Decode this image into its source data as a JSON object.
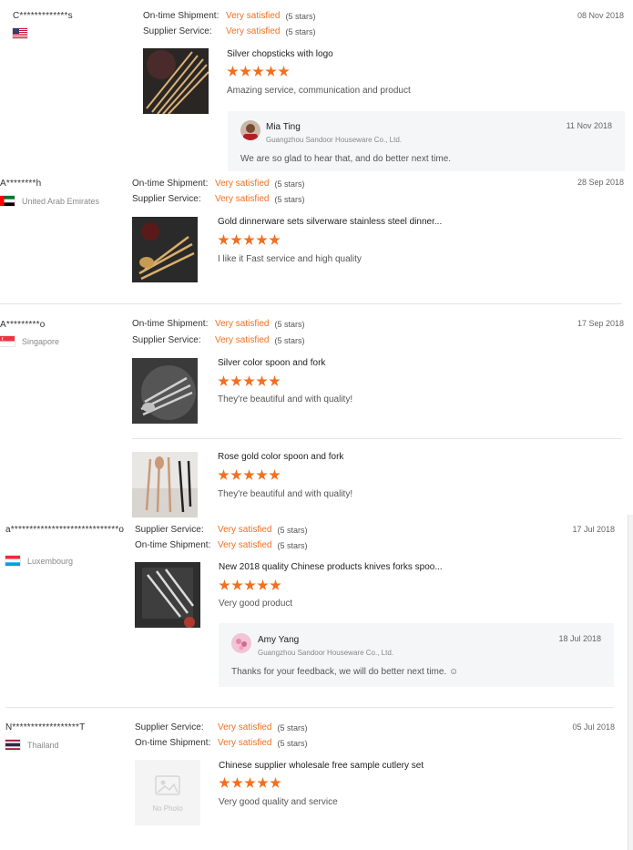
{
  "reviews": [
    {
      "buyer": "C*************s",
      "country": "",
      "flag": "us",
      "ratings": [
        {
          "label": "On-time Shipment:",
          "value": "Very satisfied",
          "stars": "(5 stars)"
        },
        {
          "label": "Supplier Service:",
          "value": "Very satisfied",
          "stars": "(5 stars)"
        }
      ],
      "date": "08 Nov 2018",
      "products": [
        {
          "title": "Silver chopsticks with logo",
          "rating": 5,
          "comment": "Amazing service, communication and product"
        }
      ],
      "reply": {
        "name": "Mia Ting",
        "company": "Guangzhou Sandoor Houseware Co., Ltd.",
        "date": "11 Nov 2018",
        "text": "We are so glad to hear that, and do better next time."
      }
    },
    {
      "buyer": "A********h",
      "country": "United Arab Emirates",
      "flag": "ae",
      "ratings": [
        {
          "label": "On-time Shipment:",
          "value": "Very satisfied",
          "stars": "(5 stars)"
        },
        {
          "label": "Supplier Service:",
          "value": "Very satisfied",
          "stars": "(5 stars)"
        }
      ],
      "date": "28 Sep 2018",
      "products": [
        {
          "title": "Gold dinnerware sets silverware stainless steel dinner...",
          "rating": 5,
          "comment": "I like it Fast service and high quality"
        }
      ]
    },
    {
      "buyer": "A*********o",
      "country": "Singapore",
      "flag": "sg",
      "ratings": [
        {
          "label": "On-time Shipment:",
          "value": "Very satisfied",
          "stars": "(5 stars)"
        },
        {
          "label": "Supplier Service:",
          "value": "Very satisfied",
          "stars": "(5 stars)"
        }
      ],
      "date": "17 Sep 2018",
      "products": [
        {
          "title": "Silver color spoon and fork",
          "rating": 5,
          "comment": "They're beautiful and with quality!"
        },
        {
          "title": "Rose gold color spoon and fork",
          "rating": 5,
          "comment": "They're beautiful and with quality!"
        }
      ]
    },
    {
      "buyer": "a*****************************o",
      "country": "Luxembourg",
      "flag": "lu",
      "ratings": [
        {
          "label": "Supplier Service:",
          "value": "Very satisfied",
          "stars": "(5 stars)"
        },
        {
          "label": "On-time Shipment:",
          "value": "Very satisfied",
          "stars": "(5 stars)"
        }
      ],
      "date": "17 Jul 2018",
      "products": [
        {
          "title": "New 2018 quality Chinese products knives forks spoo...",
          "rating": 5,
          "comment": "Very good product"
        }
      ],
      "reply": {
        "name": "Amy Yang",
        "company": "Guangzhou Sandoor Houseware Co., Ltd.",
        "date": "18 Jul 2018",
        "text": "Thanks for your feedback, we will do better next time. ☺"
      }
    },
    {
      "buyer": "N******************T",
      "country": "Thailand",
      "flag": "th",
      "ratings": [
        {
          "label": "Supplier Service:",
          "value": "Very satisfied",
          "stars": "(5 stars)"
        },
        {
          "label": "On-time Shipment:",
          "value": "Very satisfied",
          "stars": "(5 stars)"
        }
      ],
      "date": "05 Jul 2018",
      "products": [
        {
          "title": "Chinese supplier wholesale free sample cutlery set",
          "rating": 5,
          "comment": "Very good quality and service",
          "placeholder": "No Photo"
        }
      ]
    }
  ],
  "colors": {
    "accent": "#f26f21",
    "reply_bg": "#f5f6f8"
  }
}
